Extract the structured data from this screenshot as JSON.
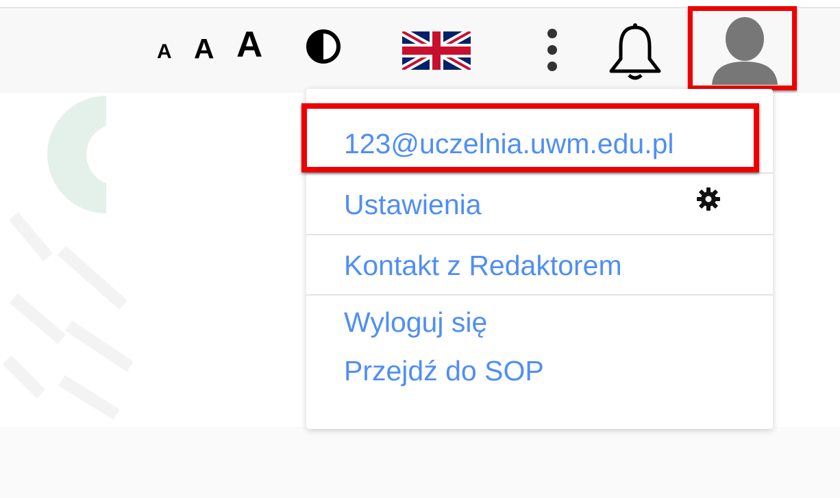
{
  "header": {
    "font_size_controls": [
      {
        "label": "A",
        "size": "small"
      },
      {
        "label": "A",
        "size": "medium"
      },
      {
        "label": "A",
        "size": "large"
      }
    ],
    "icons": [
      "contrast-icon",
      "uk-flag-icon",
      "more-vertical-icon",
      "bell-icon",
      "user-avatar-icon"
    ]
  },
  "user_menu": {
    "email": "123@uczelnia.uwm.edu.pl",
    "items": [
      {
        "label": "Ustawienia",
        "icon": "gear-icon"
      },
      {
        "label": "Kontakt z Redaktorem"
      },
      {
        "label": "Wyloguj się"
      },
      {
        "label": "Przejdź do SOP"
      }
    ]
  },
  "colors": {
    "link": "#4f8ef7",
    "highlight": "#ee0000",
    "topbar_bg": "#f8f8f8",
    "watermark": "#e4f1ea"
  }
}
